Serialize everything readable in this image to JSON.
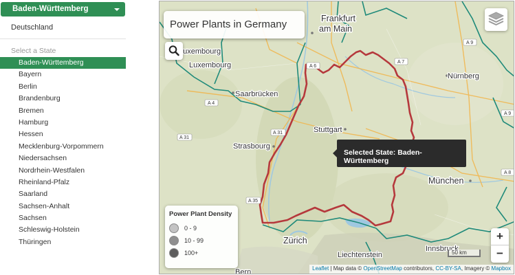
{
  "sidebar": {
    "dropdown_label": "Baden-Württemberg",
    "country_link": "Deutschland",
    "state_header": "Select a State",
    "states": [
      "Baden-Württemberg",
      "Bayern",
      "Berlin",
      "Brandenburg",
      "Bremen",
      "Hamburg",
      "Hessen",
      "Mecklenburg-Vorpommern",
      "Niedersachsen",
      "Nordrhein-Westfalen",
      "Rheinland-Pfalz",
      "Saarland",
      "Sachsen-Anhalt",
      "Sachsen",
      "Schleswig-Holstein",
      "Thüringen"
    ],
    "active_state": "Baden-Württemberg"
  },
  "map": {
    "title": "Power Plants in Germany",
    "tooltip": "Selected State: Baden-Württemberg",
    "legend": {
      "title": "Power Plant Density",
      "items": [
        {
          "label": "0 - 9",
          "color": "#c3c3c3"
        },
        {
          "label": "10 - 99",
          "color": "#8f8f8f"
        },
        {
          "label": "100+",
          "color": "#5d5d5d"
        }
      ]
    },
    "zoom_in": "+",
    "zoom_out": "−",
    "scale": "50 km",
    "attribution": {
      "leaflet": "Leaflet",
      "sep1": " | Map data © ",
      "osm": "OpenStreetMap",
      "sep2": " contributors, ",
      "license": "CC-BY-SA",
      "sep3": ", Imagery © ",
      "provider": "Mapbox"
    },
    "places": {
      "luxembourg_top": "Luxembourg",
      "luxembourg": "Luxembourg",
      "frankfurt_1": "Frankfurt",
      "frankfurt_2": "am Main",
      "nurnberg": "Nürnberg",
      "saarbrucken": "Saarbrücken",
      "stuttgart": "Stuttgart",
      "strasbourg": "Strasbourg",
      "munchen": "München",
      "zurich": "Zürich",
      "liechtenstein": "Liechtenstein",
      "innsbruck": "Innsbruck",
      "bern": "Bern"
    },
    "roads": {
      "a9": "A 9",
      "a6": "A 6",
      "a7": "A 7",
      "a4": "A 4",
      "a31": "A 31",
      "a35": "A 35",
      "a9b": "A 9",
      "a8": "A 8"
    },
    "colors": {
      "state_outline": "#b5383c",
      "country_border": "#1f8a7a",
      "land": "#dfe3c8",
      "water": "#9fc8e0"
    }
  }
}
